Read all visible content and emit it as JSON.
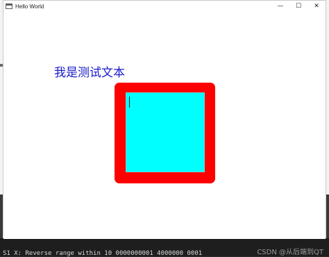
{
  "window": {
    "title": "Hello World",
    "controls": {
      "minimize": "—",
      "maximize": "☐",
      "close": "✕"
    }
  },
  "content": {
    "label": "我是测试文本",
    "label_color": "#1a1acc",
    "frame_color": "#ff0000",
    "editor_color": "#00ffff"
  },
  "console": {
    "line": "S1 X: Reverse range within 10 0000000001 4000000 0001"
  },
  "watermark": "CSDN @从后端到QT"
}
